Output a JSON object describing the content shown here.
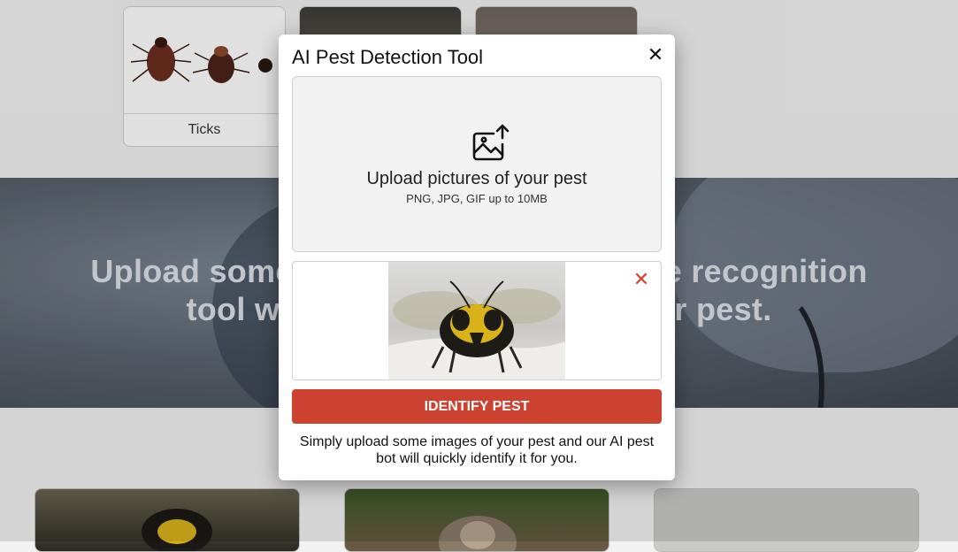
{
  "pest_cards": [
    {
      "label": "Ticks"
    },
    {
      "label": ""
    },
    {
      "label": ""
    }
  ],
  "hero": {
    "title_line1": "Upload some images to use our image recognition",
    "title_line2": "tool which will help identify your pest."
  },
  "modal": {
    "title": "AI Pest Detection Tool",
    "close_symbol": "✕",
    "dropzone": {
      "title": "Upload pictures of your pest",
      "subtitle": "PNG, JPG, GIF up to 10MB"
    },
    "remove_symbol": "✕",
    "identify_label": "IDENTIFY PEST",
    "help_text": "Simply upload some images of your pest and our AI pest bot will quickly identify it for you."
  },
  "colors": {
    "accent": "#cc4130",
    "remove": "#e03b2e"
  }
}
